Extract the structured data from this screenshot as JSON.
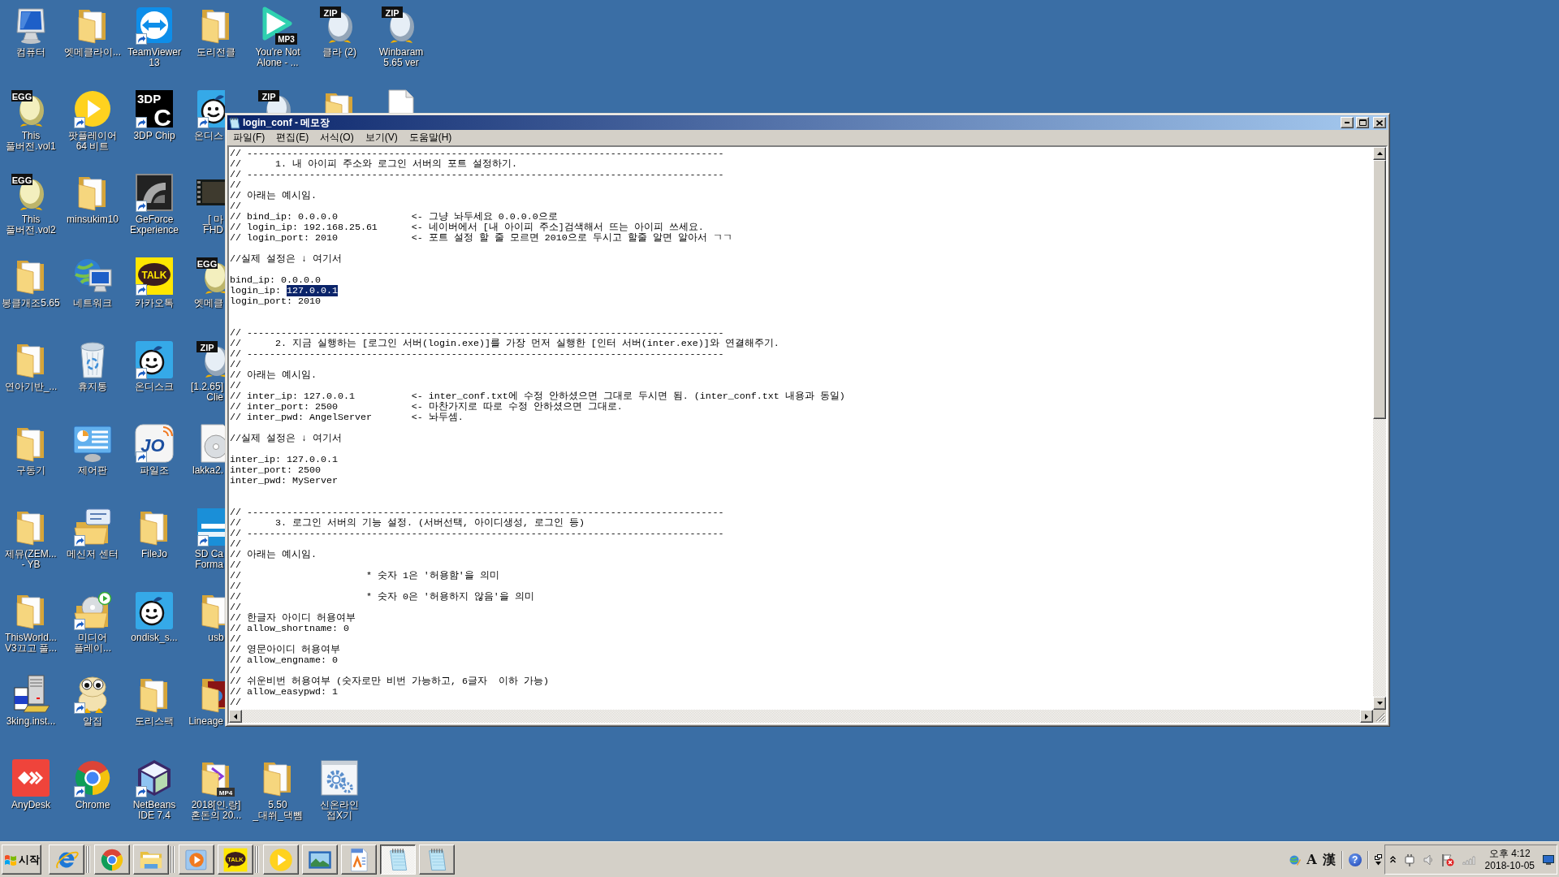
{
  "desktop": {
    "rows": [
      [
        {
          "label": "컴퓨터",
          "kind": "monitor",
          "shortcut": false
        },
        {
          "label": "엣메클라이...",
          "kind": "folder",
          "shortcut": false
        },
        {
          "label": "TeamViewer\n13",
          "kind": "arrows-tile",
          "shortcut": true
        },
        {
          "label": "도리전클",
          "kind": "folder",
          "shortcut": false
        },
        {
          "label": "You're Not\nAlone - ...",
          "kind": "play-triangle",
          "badge": [
            "MP3"
          ],
          "shortcut": false
        },
        {
          "label": "클라 (2)",
          "kind": "zip-egg",
          "badge": [
            "ZIP"
          ],
          "shortcut": false
        },
        {
          "label": "Winbaram\n5.65 ver",
          "kind": "zip-egg",
          "badge": [
            "ZIP"
          ],
          "shortcut": false
        }
      ],
      [
        {
          "label": "This\n풀버전.vol1",
          "kind": "egg",
          "badge": [
            "EGG"
          ],
          "shortcut": false
        },
        {
          "label": "팟플레이어\n64 비트",
          "kind": "play-disc",
          "shortcut": true
        },
        {
          "label": "3DP Chip",
          "kind": "letter-tile",
          "badge": [
            "3DP",
            "C"
          ],
          "shortcut": true
        },
        {
          "label": "온디스",
          "kind": "face-tile",
          "shortcut": true
        },
        {
          "kind": "zip-egg",
          "badge": [
            "ZIP"
          ],
          "shortcut": false
        },
        {
          "kind": "folder",
          "shortcut": false
        },
        {
          "kind": "blank-file",
          "shortcut": false
        }
      ],
      [
        {
          "label": "This\n풀버전.vol2",
          "kind": "egg",
          "badge": [
            "EGG"
          ],
          "shortcut": false
        },
        {
          "label": "minsukim10",
          "kind": "folder",
          "shortcut": false
        },
        {
          "label": "GeForce\nExperience",
          "kind": "dark-tile",
          "shortcut": true
        },
        {
          "label": "_[ 마\nFHD",
          "kind": "film",
          "shortcut": false
        }
      ],
      [
        {
          "label": "봉클개조5.65",
          "kind": "folder",
          "shortcut": false
        },
        {
          "label": "네트워크",
          "kind": "globe-monitor",
          "shortcut": false
        },
        {
          "label": "카카오톡",
          "kind": "talk-tile",
          "badge": [
            "TALK"
          ],
          "shortcut": true
        },
        {
          "label": "엣메클",
          "kind": "egg",
          "badge": [
            "EGG"
          ],
          "shortcut": false
        }
      ],
      [
        {
          "label": "연아기반_...",
          "kind": "folder",
          "shortcut": false
        },
        {
          "label": "휴지통",
          "kind": "bin",
          "shortcut": false
        },
        {
          "label": "온디스크",
          "kind": "face-tile",
          "shortcut": true
        },
        {
          "label": "[1.2.65]\nClie",
          "kind": "zip-egg",
          "badge": [
            "ZIP"
          ],
          "shortcut": false
        }
      ],
      [
        {
          "label": "구동기",
          "kind": "folder",
          "shortcut": false
        },
        {
          "label": "제어판",
          "kind": "panel",
          "shortcut": false
        },
        {
          "label": "파일조",
          "kind": "jo-tile",
          "badge": [
            "JO"
          ],
          "shortcut": true
        },
        {
          "label": "lakka2.",
          "kind": "disc",
          "shortcut": false
        }
      ],
      [
        {
          "label": "제뮤(ZEM...\n- YB",
          "kind": "folder",
          "shortcut": false
        },
        {
          "label": "메신저 센터",
          "kind": "chat-folder",
          "shortcut": true
        },
        {
          "label": "FileJo",
          "kind": "folder",
          "shortcut": false
        },
        {
          "label": "SD Ca\nForma",
          "kind": "sd-tile",
          "shortcut": true
        }
      ],
      [
        {
          "label": "ThisWorld...\nV3끄고 풀...",
          "kind": "folder",
          "shortcut": false
        },
        {
          "label": "미디어\n플레이...",
          "kind": "disc-folder",
          "shortcut": true
        },
        {
          "label": "ondisk_s...",
          "kind": "face-tile",
          "shortcut": false
        },
        {
          "label": "usb",
          "kind": "folder",
          "shortcut": false
        }
      ],
      [
        {
          "label": "3king.inst...",
          "kind": "server",
          "shortcut": false
        },
        {
          "label": "알집",
          "kind": "creature",
          "shortcut": true
        },
        {
          "label": "도리스팩",
          "kind": "folder",
          "shortcut": false
        },
        {
          "label": "Lineage",
          "kind": "picture-folder",
          "shortcut": false
        }
      ],
      [
        {
          "label": "AnyDesk",
          "kind": "diamond-tile",
          "shortcut": false
        },
        {
          "label": "Chrome",
          "kind": "wheel",
          "shortcut": true
        },
        {
          "label": "NetBeans\nIDE 7.4",
          "kind": "cube",
          "shortcut": true
        },
        {
          "label": "2018[인.랑]\n혼돈의 20...",
          "kind": "video-folder",
          "badge": [
            "MP4"
          ],
          "shortcut": false
        },
        {
          "label": "5.50\n_대쒸_댁뻼",
          "kind": "folder",
          "shortcut": false
        },
        {
          "label": "신온라인\n접X기",
          "kind": "gear-window",
          "shortcut": false
        }
      ]
    ]
  },
  "window": {
    "title": "login_conf - 메모장",
    "menu": [
      "파일(F)",
      "편집(E)",
      "서식(O)",
      "보기(V)",
      "도움말(H)"
    ],
    "sections": [
      {
        "lines": [
          "// ------------------------------------------------------------------------------------",
          "//\t1. 내 아이피 주소와 로그인 서버의 포트 설정하기.",
          "// ------------------------------------------------------------------------------------",
          "//",
          "// 아래는 예시임.",
          "//",
          "// bind_ip: 0.0.0.0\t\t<- 그냥 놔두세요 0.0.0.0으로",
          "// login_ip: 192.168.25.61\t<- 네이버에서 [내 아이피 주소]검색해서 뜨는 아이피 쓰세요.",
          "// login_port: 2010\t\t<- 포트 설정 할 줄 모르면 2010으로 두시고 할줄 알면 알아서 ㄱㄱ"
        ],
        "note": "//실제 설정은 ↓ 여기서",
        "settings": [
          {
            "text": "bind_ip: 0.0.0.0"
          },
          {
            "text": "login_ip: ",
            "selection": "127.0.0.1"
          },
          {
            "text": "login_port: 2010"
          }
        ]
      },
      {
        "lines": [
          "// ------------------------------------------------------------------------------------",
          "//\t2. 지금 실행하는 [로그인 서버(login.exe)]를 가장 먼저 실행한 [인터 서버(inter.exe)]와 연결해주기.",
          "// ------------------------------------------------------------------------------------",
          "//",
          "// 아래는 예시임.",
          "//",
          "// inter_ip: 127.0.0.1\t\t<- inter_conf.txt에 수정 안하셨으면 그대로 두시면 됨. (inter_conf.txt 내용과 동일)",
          "// inter_port: 2500\t\t<- 마찬가지로 따로 수정 안하셨으면 그대로.",
          "// inter_pwd: AngelServer\t<- 놔두셈."
        ],
        "note": "//실제 설정은 ↓ 여기서",
        "settings": [
          {
            "text": "inter_ip: 127.0.0.1"
          },
          {
            "text": "inter_port: 2500"
          },
          {
            "text": "inter_pwd: MyServer"
          }
        ]
      },
      {
        "lines": [
          "// ------------------------------------------------------------------------------------",
          "//\t3. 로그인 서버의 기능 설정. (서버선택, 아이디생성, 로그인 등)",
          "// ------------------------------------------------------------------------------------",
          "//",
          "// 아래는 예시임.",
          "//",
          "//\t\t\t* 숫자 1은 '허용함'을 의미",
          "//",
          "//\t\t\t* 숫자 0은 '허용하지 않음'을 의미",
          "//",
          "// 한글자 아이디 허용여부",
          "// allow_shortname: 0",
          "//",
          "// 영문아이디 허용여부",
          "// allow_engname: 0",
          "//",
          "// 쉬운비번 허용여부 (숫자로만 비번 가능하고, 6글자  이하 가능)",
          "// allow_easypwd: 1",
          "//"
        ]
      }
    ]
  },
  "taskbar": {
    "start": "시작",
    "groups": [
      [
        {
          "kind": "ring-logo",
          "selected": false
        }
      ],
      [
        {
          "kind": "wheel",
          "selected": false
        },
        {
          "kind": "files-folder",
          "selected": false
        }
      ],
      [
        {
          "kind": "play-window",
          "selected": false
        },
        {
          "kind": "talk-tile",
          "badge": [
            "TALK"
          ],
          "selected": false
        }
      ],
      [
        {
          "kind": "play-disc",
          "selected": false
        },
        {
          "kind": "photo",
          "selected": false
        },
        {
          "kind": "document",
          "selected": false
        },
        {
          "kind": "notebook",
          "selected": true
        },
        {
          "kind": "notebook",
          "selected": false
        }
      ]
    ],
    "language_bar": {
      "input_mode": "A",
      "hanja": "漢",
      "help": "?"
    },
    "clock": {
      "time": "오후 4:12",
      "date": "2018-10-05"
    }
  }
}
